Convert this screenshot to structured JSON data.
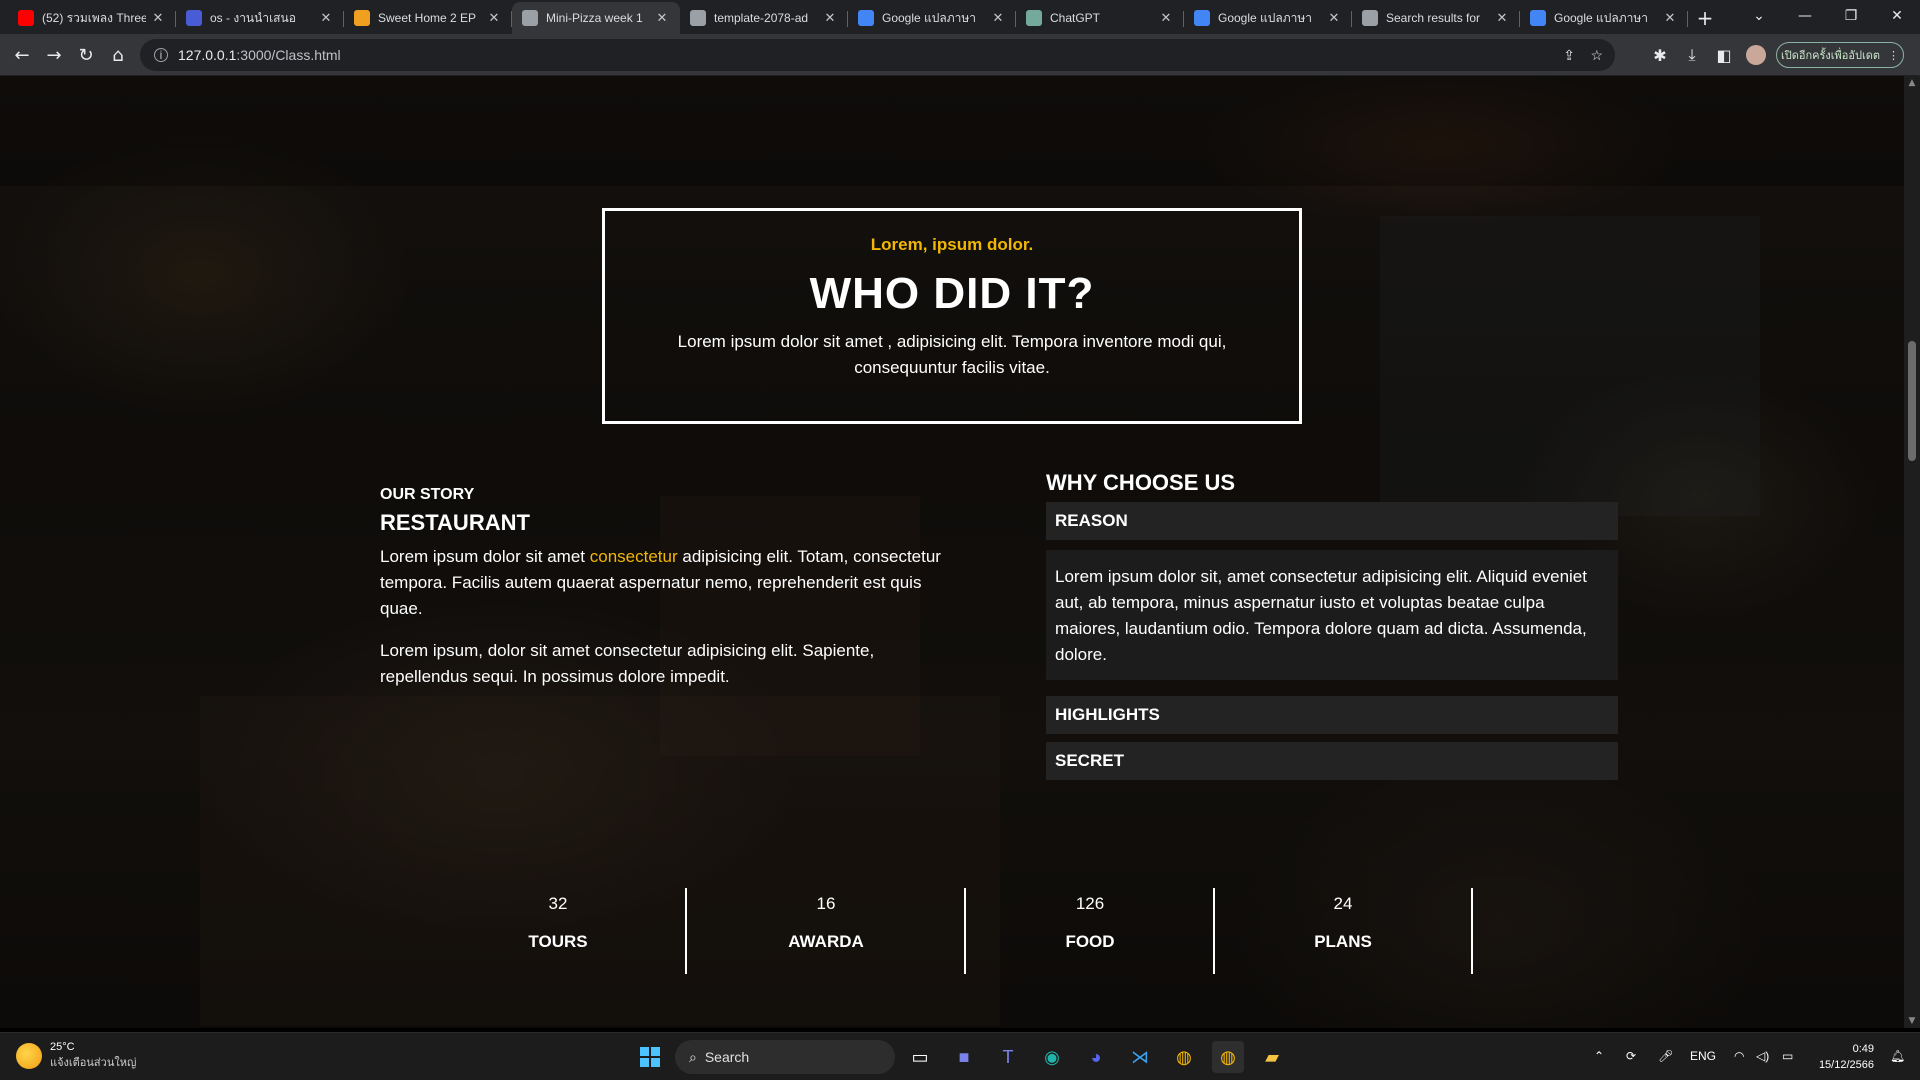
{
  "browser": {
    "tabs": [
      {
        "title": "(52) รวมเพลง Three",
        "favicon_color": "#ff0000",
        "icon": "youtube-icon",
        "active": false
      },
      {
        "title": "os - งานนำเสนอ",
        "favicon_color": "#4a5bd6",
        "icon": "shield-icon",
        "active": false
      },
      {
        "title": "Sweet Home 2 EP",
        "favicon_color": "#f0a020",
        "icon": "book-icon",
        "active": false
      },
      {
        "title": "Mini-Pizza week 1",
        "favicon_color": "#9aa0a6",
        "icon": "globe-icon",
        "active": true
      },
      {
        "title": "template-2078-ad",
        "favicon_color": "#9aa0a6",
        "icon": "globe-icon",
        "active": false
      },
      {
        "title": "Google แปลภาษา",
        "favicon_color": "#4285f4",
        "icon": "translate-icon",
        "active": false
      },
      {
        "title": "ChatGPT",
        "favicon_color": "#74aa9c",
        "icon": "chatgpt-icon",
        "active": false
      },
      {
        "title": "Google แปลภาษา",
        "favicon_color": "#4285f4",
        "icon": "translate-icon",
        "active": false
      },
      {
        "title": "Search results for",
        "favicon_color": "#9aa0a6",
        "icon": "globe-icon",
        "active": false
      },
      {
        "title": "Google แปลภาษา",
        "favicon_color": "#4285f4",
        "icon": "translate-icon",
        "active": false
      }
    ],
    "url_host": "127.0.0.1",
    "url_rest": ":3000/Class.html",
    "update_button": "เปิดอีกครั้งเพื่ออัปเดต"
  },
  "page": {
    "hero": {
      "kicker": "Lorem, ipsum dolor.",
      "title": "WHO DID IT?",
      "text": "Lorem ipsum dolor sit amet , adipisicing elit. Tempora inventore modi qui, consequuntur facilis vitae."
    },
    "story": {
      "subtitle": "OUR STORY",
      "title": "RESTAURANT",
      "p1_before": "Lorem ipsum dolor sit amet ",
      "p1_highlight": "consectetur",
      "p1_after": " adipisicing elit. Totam, consectetur tempora. Facilis autem quaerat aspernatur nemo, reprehenderit est quis quae.",
      "p2": "Lorem ipsum, dolor sit amet consectetur adipisicing elit. Sapiente, repellendus sequi. In possimus dolore impedit."
    },
    "why": {
      "title": "WHY CHOOSE US",
      "items": [
        {
          "label": "REASON",
          "body": "Lorem ipsum dolor sit, amet consectetur adipisicing elit. Aliquid eveniet aut, ab tempora, minus aspernatur iusto et voluptas beatae culpa maiores, laudantium odio. Tempora dolore quam ad dicta. Assumenda, dolore."
        },
        {
          "label": "HIGHLIGHTS"
        },
        {
          "label": "SECRET"
        }
      ]
    },
    "stats": [
      {
        "value": "32",
        "label": "TOURS"
      },
      {
        "value": "16",
        "label": "AWARDA"
      },
      {
        "value": "126",
        "label": "FOOD"
      },
      {
        "value": "24",
        "label": "PLANS"
      }
    ],
    "accent_color": "#f2b705"
  },
  "taskbar": {
    "weather_temp": "25°C",
    "weather_desc": "แจ้งเตือนส่วนใหญ่",
    "search_label": "Search",
    "lang": "ENG",
    "time": "0:49",
    "date": "15/12/2566"
  }
}
